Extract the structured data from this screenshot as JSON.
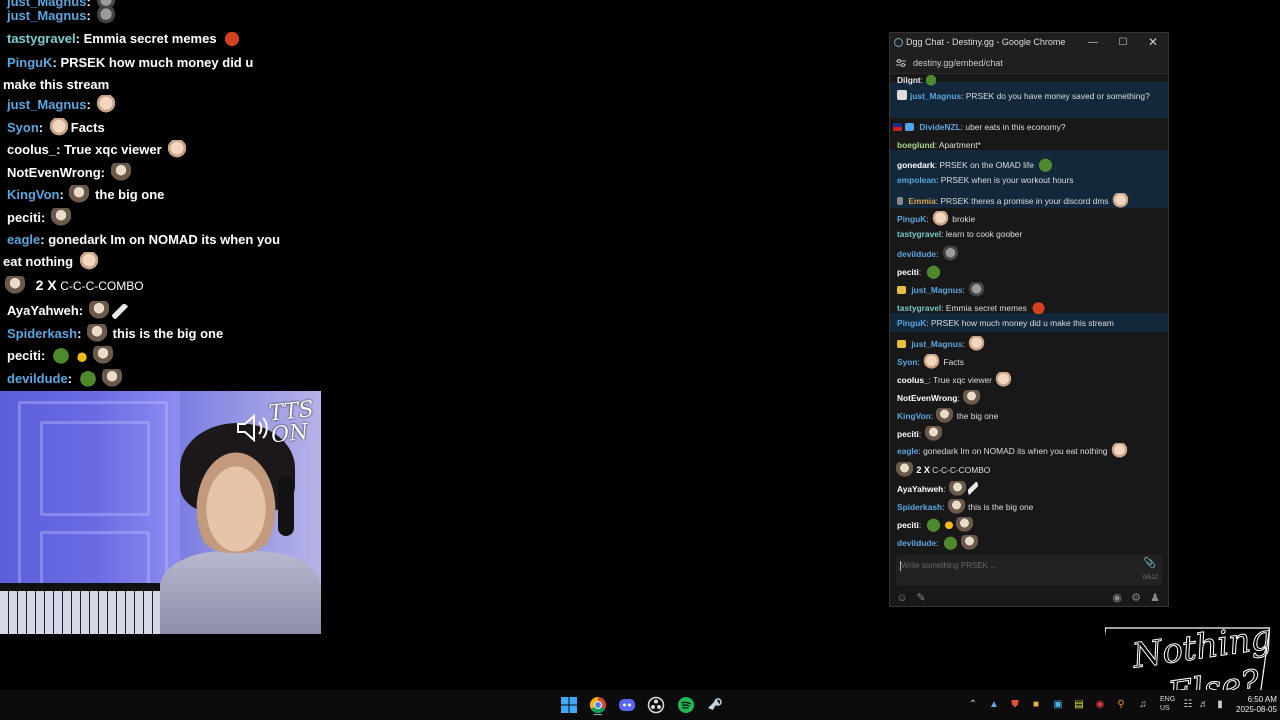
{
  "overlay_chat": {
    "lines": [
      {
        "user": "just_Magnus",
        "text": ""
      },
      {
        "user": "tastygravel",
        "text": "Emmia secret memes"
      },
      {
        "user": "PinguK",
        "text": "PRSEK how much money did u make this stream"
      },
      {
        "user": "just_Magnus",
        "text": ""
      },
      {
        "user": "Syon",
        "text": "Facts"
      },
      {
        "user": "coolus_",
        "text": "True xqc viewer"
      },
      {
        "user": "NotEvenWrong",
        "text": ""
      },
      {
        "user": "KingVon",
        "text": "the big one"
      },
      {
        "user": "peciti",
        "text": ""
      },
      {
        "user": "eagle",
        "text": "gonedark Im on NOMAD its when you eat nothing"
      },
      {
        "user": "",
        "text": "C-C-C-COMBO",
        "combo": "2 X"
      },
      {
        "user": "AyaYahweh",
        "text": ""
      },
      {
        "user": "Spiderkash",
        "text": "this is the big one"
      },
      {
        "user": "peciti",
        "text": ""
      },
      {
        "user": "devildude",
        "text": ""
      }
    ]
  },
  "webcam": {
    "tts_label": "TTS ON"
  },
  "chat_window": {
    "title": "Dgg Chat - Destiny.gg - Google Chrome",
    "url": "destiny.gg/embed/chat",
    "messages": [
      {
        "user": "Dilgnt",
        "text": ""
      },
      {
        "user": "just_Magnus",
        "text": "PRSEK do you have money saved or something?"
      },
      {
        "user": "DivideNZL",
        "text": "uber eats in this economy?"
      },
      {
        "user": "boeglund",
        "text": "Apartment*"
      },
      {
        "user": "gonedark",
        "text": "PRSEK on the OMAD life"
      },
      {
        "user": "empolean",
        "text": "PRSEK when is your workout hours"
      },
      {
        "user": "Emmia",
        "text": "PRSEK theres a promise in your discord dms"
      },
      {
        "user": "PinguK",
        "text": "brokie"
      },
      {
        "user": "tastygravel",
        "text": "learn to cook goober"
      },
      {
        "user": "devildude",
        "text": ""
      },
      {
        "user": "peciti",
        "text": ""
      },
      {
        "user": "just_Magnus",
        "text": ""
      },
      {
        "user": "tastygravel",
        "text": "Emmia secret memes"
      },
      {
        "user": "PinguK",
        "text": "PRSEK how much money did u make this stream"
      },
      {
        "user": "just_Magnus",
        "text": ""
      },
      {
        "user": "Syon",
        "text": "Facts"
      },
      {
        "user": "coolus_",
        "text": "True xqc viewer"
      },
      {
        "user": "NotEvenWrong",
        "text": ""
      },
      {
        "user": "KingVon",
        "text": "the big one"
      },
      {
        "user": "peciti",
        "text": ""
      },
      {
        "user": "eagle",
        "text": "gonedark Im on NOMAD its when you eat nothing"
      },
      {
        "user": "",
        "text": "C-C-C-COMBO",
        "combo": "2 X"
      },
      {
        "user": "AyaYahweh",
        "text": ""
      },
      {
        "user": "Spiderkash",
        "text": "this is the big one"
      },
      {
        "user": "peciti",
        "text": ""
      },
      {
        "user": "devildude",
        "text": ""
      }
    ],
    "input": {
      "placeholder": "Write something PRSEK ...",
      "counter": "0/512"
    }
  },
  "logo": {
    "text_line1": "Nothing",
    "text_line2": "Else?"
  },
  "taskbar": {
    "apps": [
      "windows-start",
      "chrome",
      "discord",
      "obs",
      "spotify",
      "steam"
    ],
    "lang_line1": "ENG",
    "lang_line2": "US",
    "time": "6:50 AM",
    "date": "2025-08-05"
  },
  "colors": {
    "highlight_row": "#13283a",
    "chat_bg": "#181818",
    "username_blue": "#5aa6e0"
  }
}
